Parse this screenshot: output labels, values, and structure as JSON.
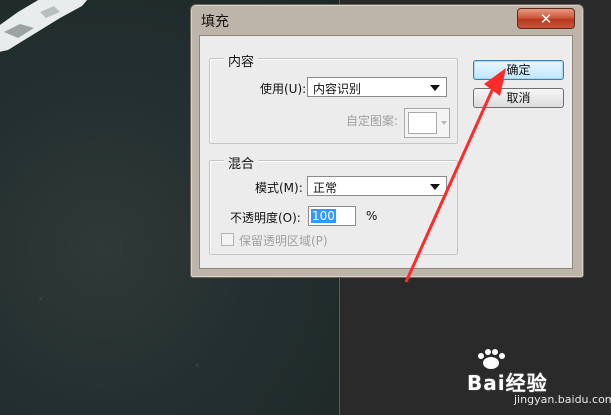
{
  "dialog": {
    "title": "填充",
    "close_symbol": "✕",
    "content_group": {
      "legend": "内容",
      "use_label": "使用(U):",
      "use_value": "内容识别",
      "custom_pattern_label": "自定图案:"
    },
    "blend_group": {
      "legend": "混合",
      "mode_label": "模式(M):",
      "mode_value": "正常",
      "opacity_label": "不透明度(O):",
      "opacity_value": "100",
      "opacity_unit": "%",
      "preserve_transparency_label": "保留透明区域(P)",
      "preserve_transparency_checked": false
    },
    "ok_label": "确定",
    "cancel_label": "取消"
  },
  "watermark": {
    "brand": "Bai经验",
    "url": "jingyan.baidu.com"
  },
  "colors": {
    "arrow": "#ff2a2a",
    "default_button_border": "#3c7fb1",
    "close_button": "#c9553a",
    "selection": "#3399ff"
  }
}
